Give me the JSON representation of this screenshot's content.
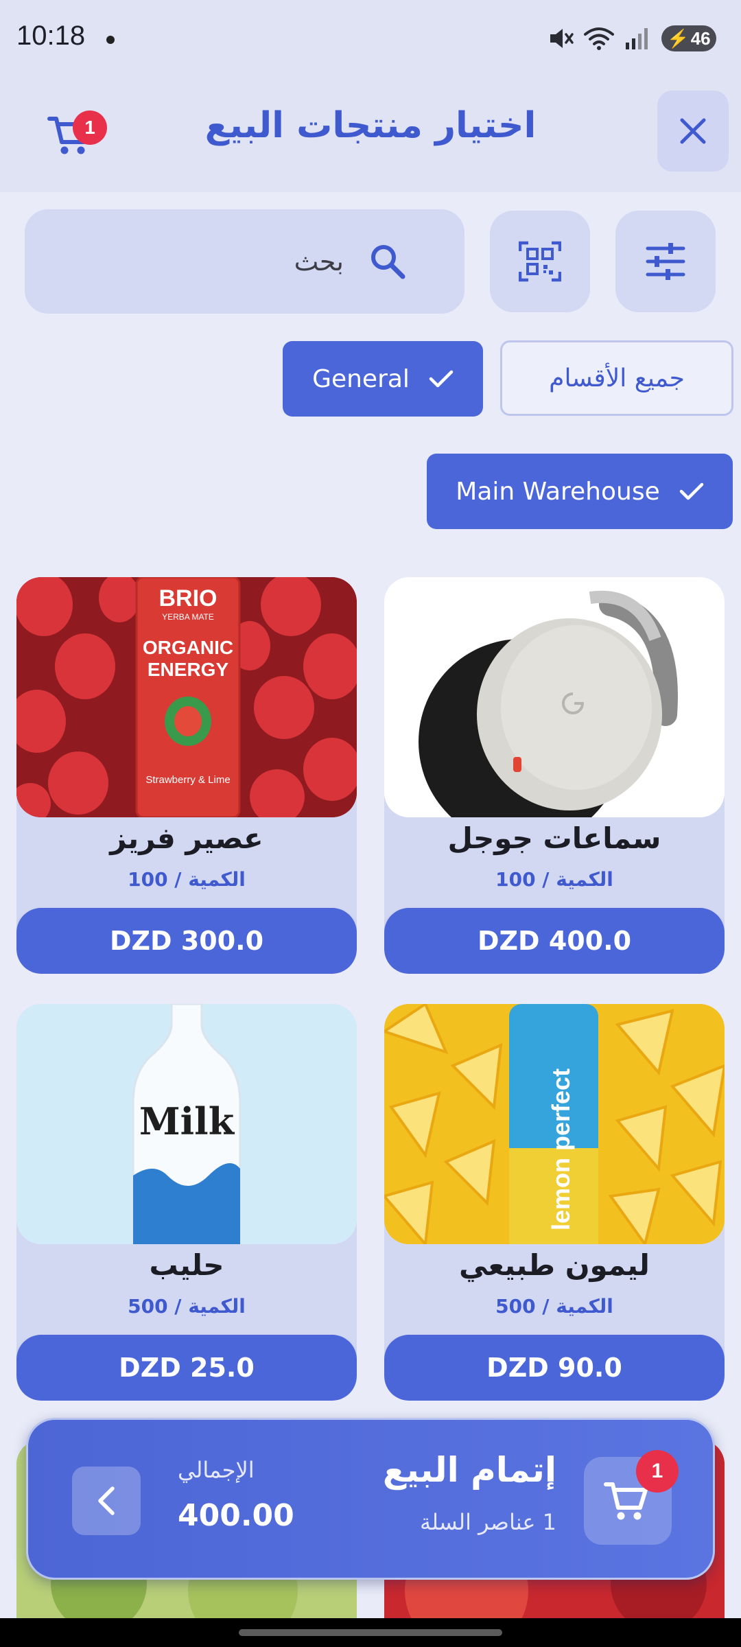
{
  "status_bar": {
    "time": "10:18",
    "battery": "46"
  },
  "header": {
    "title": "اختيار منتجات البيع",
    "cart_badge": "1",
    "close_icon": "close-icon",
    "cart_icon": "cart-icon"
  },
  "search": {
    "placeholder": "بحث",
    "value": ""
  },
  "filters": {
    "all_categories": "جميع الأقسام",
    "general": "General",
    "warehouse": "Main Warehouse"
  },
  "products": [
    {
      "name": "سماعات جوجل",
      "qty_label": "الكمية / 100",
      "price": "DZD 400.0",
      "image": "headphones"
    },
    {
      "name": "عصير فريز",
      "qty_label": "الكمية / 100",
      "price": "DZD 300.0",
      "image": "strawberry-can"
    },
    {
      "name": "ليمون طبيعي",
      "qty_label": "الكمية / 500",
      "price": "DZD 90.0",
      "image": "lemon-bottle"
    },
    {
      "name": "حليب",
      "qty_label": "الكمية / 500",
      "price": "DZD 25.0",
      "image": "milk-bottle"
    }
  ],
  "product_images": {
    "brio_brand": "BRIO",
    "brio_sub": "YERBA MATE",
    "brio_line1": "ORGANIC",
    "brio_line2": "ENERGY",
    "brio_flavor": "Strawberry & Lime",
    "lemon_brand": "lemon perfect",
    "milk_label": "Milk"
  },
  "checkout": {
    "title": "إتمام البيع",
    "items_count": "1 عناصر السلة",
    "total_label": "الإجمالي",
    "total_value": "400.00",
    "cart_badge": "1"
  },
  "colors": {
    "accent": "#4b66d8",
    "badge": "#e8304a",
    "background": "#e9ebf8"
  }
}
